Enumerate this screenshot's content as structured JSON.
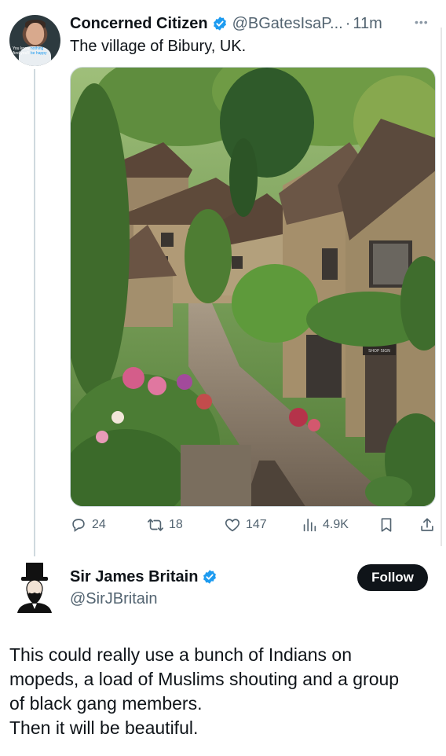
{
  "thread": {
    "first_post": {
      "display_name": "Concerned Citizen",
      "verified": true,
      "handle": "@BGatesIsaP...",
      "separator": "·",
      "time": "11m",
      "more_icon": "more-horizontal-icon",
      "avatar_caption_line1": "You know ",
      "avatar_caption_highlight1": "nothing",
      "avatar_caption_line2": "And you'll ",
      "avatar_caption_highlight2": "be happy",
      "text": "The village of Bibury, UK.",
      "image_alt": "Photo of a cobbled lane between stone cottages covered in greenery and flowers",
      "image_sign_text": "SHOP SIGN",
      "metrics": {
        "replies": "24",
        "reposts": "18",
        "likes": "147",
        "views": "4.9K"
      },
      "icons": [
        "reply-icon",
        "repost-icon",
        "like-icon",
        "views-icon",
        "bookmark-icon",
        "share-icon"
      ]
    },
    "second_post": {
      "display_name": "Sir James Britain",
      "verified": true,
      "handle": "@SirJBritain",
      "follow_label": "Follow",
      "text_lines": [
        "This could really use a bunch of Indians on",
        "mopeds, a load of Muslims shouting and a group",
        "of black gang members.",
        "Then it will be beautiful."
      ]
    }
  },
  "colors": {
    "text_primary": "#0f1419",
    "text_secondary": "#536471",
    "verified_blue": "#1d9bf0",
    "thread_line": "#cfd9de",
    "follow_bg": "#0f1419"
  }
}
